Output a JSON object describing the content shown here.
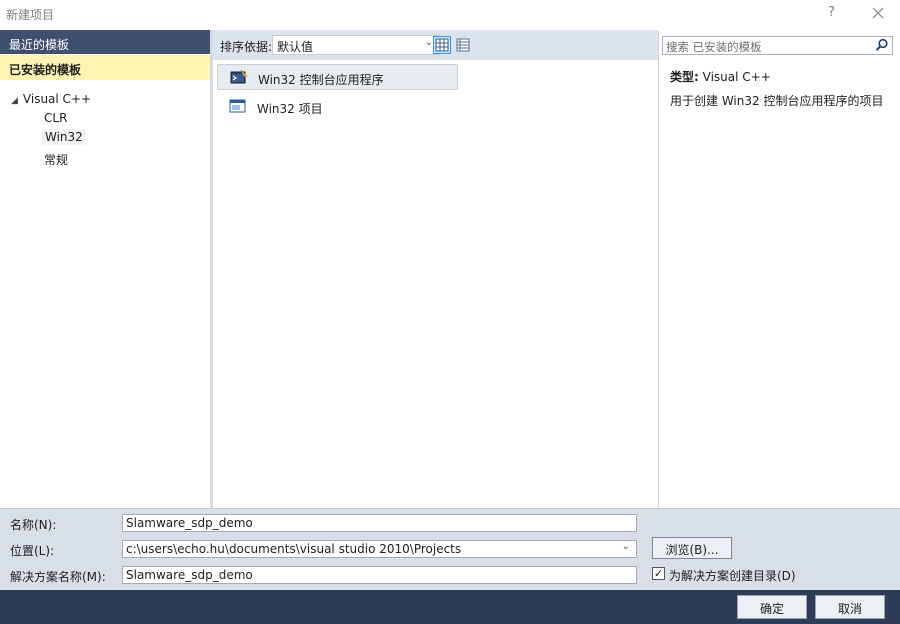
{
  "window": {
    "title": "新建项目",
    "help_glyph": "?",
    "close_icon": "close-icon"
  },
  "sidebar": {
    "recent_label": "最近的模板",
    "installed_label": "已安装的模板",
    "tree": {
      "root": "Visual C++",
      "children": [
        "CLR",
        "Win32",
        "常规"
      ],
      "selected": "Win32"
    }
  },
  "toolbar": {
    "sort_label": "排序依据:",
    "sort_value": "默认值",
    "view_icons": [
      "list-view-icon",
      "details-view-icon"
    ]
  },
  "templates": [
    {
      "name": "Win32 控制台应用程序",
      "icon": "console-app-icon",
      "selected": true
    },
    {
      "name": "Win32 项目",
      "icon": "window-project-icon",
      "selected": false
    }
  ],
  "search": {
    "placeholder": "搜索 已安装的模板",
    "icon": "search-icon"
  },
  "description": {
    "type_label": "类型:",
    "type_value": "Visual C++",
    "text": "用于创建 Win32 控制台应用程序的项目"
  },
  "form": {
    "name_label": "名称(N):",
    "name_value": "Slamware_sdp_demo",
    "location_label": "位置(L):",
    "location_value": "c:\\users\\echo.hu\\documents\\visual studio 2010\\Projects",
    "solution_label": "解决方案名称(M):",
    "solution_value": "Slamware_sdp_demo",
    "browse_label": "浏览(B)...",
    "create_dir_label": "为解决方案创建目录(D)",
    "create_dir_checked": true
  },
  "footer": {
    "ok_label": "确定",
    "cancel_label": "取消"
  },
  "colors": {
    "accent_dark": "#2d3b57",
    "selected_category": "#fdf3b3",
    "header_band": "#3f4f6e",
    "form_background": "#d9dfe9"
  }
}
